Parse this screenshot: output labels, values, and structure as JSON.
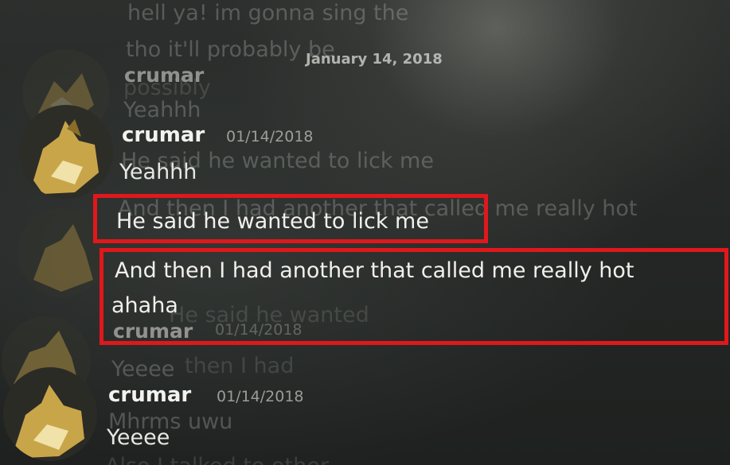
{
  "colors": {
    "background": "#252826",
    "text": "#e6e7e3",
    "highlight": "#e0181b",
    "avatar_fur": "#c9a54a"
  },
  "date_divider": "January 14, 2018",
  "ghost_lines": {
    "top1": "hell ya! im gonna sing the",
    "top2": "tho it'll probably be",
    "possibly": "possibly",
    "yeahhh": "Yeahhh",
    "lick_ghost": "He said he wanted to lick me",
    "hot_ghost": "And then I had another that called me really hot",
    "he_ghost": "He said he wanted",
    "crumar_ghost": "crumar",
    "stamp_ghost": "01/14/2018",
    "yeeee_ghost": "Yeeee",
    "then_ghost": "then I had",
    "mhrms": "Mhrms uwu",
    "bottom": "Also I talked to other"
  },
  "messages": [
    {
      "username": "crumar",
      "timestamp": "01/14/2018",
      "lines": [
        "Yeahhh"
      ]
    },
    {
      "username": "",
      "timestamp": "",
      "lines": [
        "He said he wanted to lick me",
        "And then I had another that called me really hot",
        "ahaha"
      ]
    },
    {
      "username": "crumar",
      "timestamp": "01/14/2018",
      "lines": [
        "Yeeee"
      ]
    }
  ],
  "overlay_users": {
    "top": "crumar",
    "middle": "crumar"
  }
}
